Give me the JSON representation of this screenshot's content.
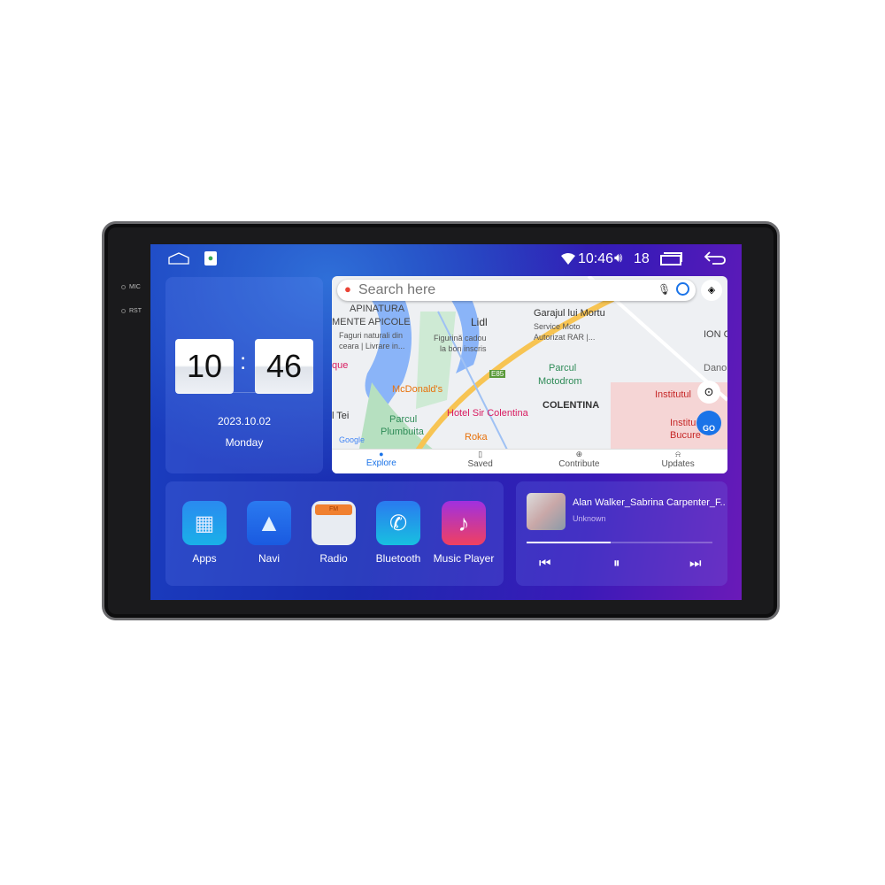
{
  "bezel": {
    "mic_label": "MIC",
    "rst_label": "RST"
  },
  "status_bar": {
    "time": "10:46",
    "volume": "18",
    "icons": [
      "home-icon",
      "maps-app-icon",
      "wifi-icon",
      "volume-icon",
      "recent-apps-icon",
      "back-icon"
    ]
  },
  "clock_widget": {
    "hours": "10",
    "minutes": "46",
    "separator": ":",
    "date": "2023.10.02",
    "weekday": "Monday"
  },
  "maps": {
    "search_placeholder": "Search here",
    "labels": [
      "APINATURA",
      "MENTE APICOLE",
      "Faguri naturali din",
      "ceara | Livrare in...",
      "Lidl",
      "Figurină cadou",
      "la bon inscris",
      "Garajul lui Mortu",
      "Service Moto",
      "Autorizat RAR |...",
      "ION C",
      "Parcul",
      "Motodrom",
      "McDonald's",
      "Hotel Sir Colentina",
      "COLENTINA",
      "Institutul",
      "Parcul",
      "Plumbuita",
      "Roka",
      "l Tei",
      "que",
      "Dano",
      "Institu",
      "Bucure",
      "E85",
      "Google"
    ],
    "go_label": "GO",
    "tabs": [
      {
        "label": "Explore",
        "active": true
      },
      {
        "label": "Saved"
      },
      {
        "label": "Contribute"
      },
      {
        "label": "Updates"
      }
    ],
    "accent": "#1a73e8"
  },
  "apps": [
    {
      "label": "Apps"
    },
    {
      "label": "Navi"
    },
    {
      "label": "Radio",
      "badge": "FM"
    },
    {
      "label": "Bluetooth"
    },
    {
      "label": "Music Player"
    }
  ],
  "music": {
    "title": "Alan Walker_Sabrina Carpenter_F...",
    "artist": "Unknown",
    "progress_percent": 45
  }
}
